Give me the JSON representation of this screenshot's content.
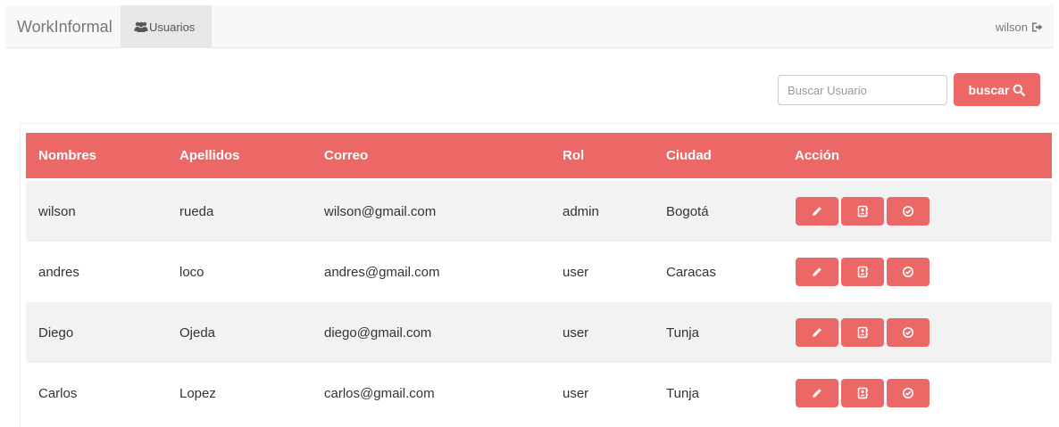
{
  "colors": {
    "accent": "#ec6866",
    "navbar_bg": "#f8f8f8",
    "active_nav_bg": "#e7e7e7",
    "stripe": "#f2f2f2"
  },
  "navbar": {
    "brand": "WorkInformal",
    "nav_item": {
      "label": "Usuarios",
      "icon": "users-icon"
    },
    "user": {
      "label": "wilson",
      "icon": "sign-out-icon"
    }
  },
  "search": {
    "placeholder": "Buscar Usuario",
    "value": "",
    "button_label": "buscar",
    "button_icon": "search-icon"
  },
  "table": {
    "headers": [
      "Nombres",
      "Apellidos",
      "Correo",
      "Rol",
      "Ciudad",
      "Acción"
    ],
    "rows": [
      {
        "nombres": "wilson",
        "apellidos": "rueda",
        "correo": "wilson@gmail.com",
        "rol": "admin",
        "ciudad": "Bogotá"
      },
      {
        "nombres": "andres",
        "apellidos": "loco",
        "correo": "andres@gmail.com",
        "rol": "user",
        "ciudad": "Caracas"
      },
      {
        "nombres": "Diego",
        "apellidos": "Ojeda",
        "correo": "diego@gmail.com",
        "rol": "user",
        "ciudad": "Tunja"
      },
      {
        "nombres": "Carlos",
        "apellidos": "Lopez",
        "correo": "carlos@gmail.com",
        "rol": "user",
        "ciudad": "Tunja"
      }
    ],
    "action_icons": [
      "pencil-icon",
      "contact-book-icon",
      "check-circle-icon"
    ]
  }
}
